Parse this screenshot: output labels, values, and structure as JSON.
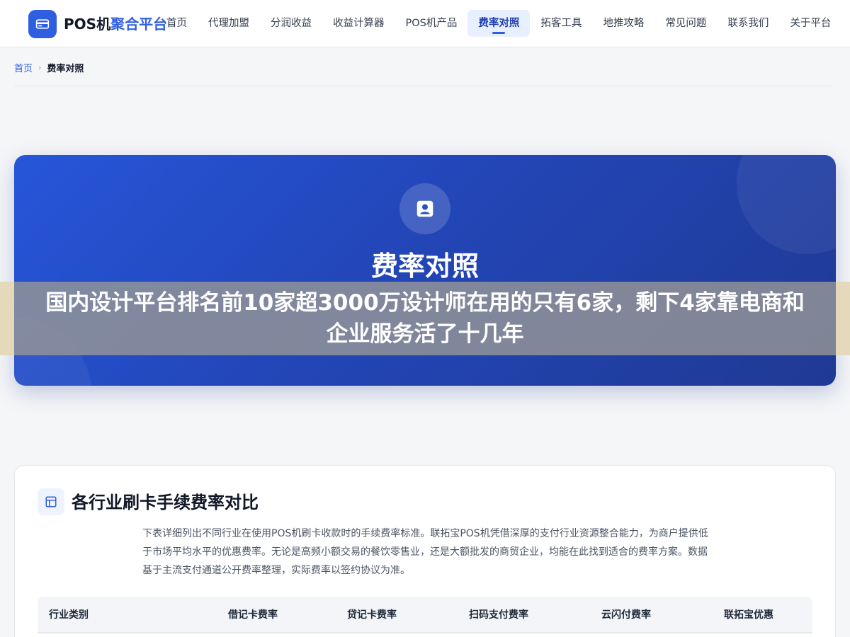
{
  "header": {
    "brand_prefix": "POS机",
    "brand_suffix": "聚合平台",
    "logo_icon": "credit-card-icon",
    "nav": [
      {
        "label": "首页",
        "active": false
      },
      {
        "label": "代理加盟",
        "active": false
      },
      {
        "label": "分润收益",
        "active": false
      },
      {
        "label": "收益计算器",
        "active": false
      },
      {
        "label": "POS机产品",
        "active": false
      },
      {
        "label": "费率对照",
        "active": true
      },
      {
        "label": "拓客工具",
        "active": false
      },
      {
        "label": "地推攻略",
        "active": false
      },
      {
        "label": "常见问题",
        "active": false
      },
      {
        "label": "联系我们",
        "active": false
      },
      {
        "label": "关于平台",
        "active": false
      }
    ]
  },
  "breadcrumb": {
    "home": "首页",
    "separator": "›",
    "current": "费率对照"
  },
  "hero": {
    "icon": "contact-card-icon",
    "title": "费率对照"
  },
  "overlay": {
    "text": "国内设计平台排名前10家超3000万设计师在用的只有6家，剩下4家靠电商和企业服务活了十几年"
  },
  "section": {
    "icon": "table-icon",
    "title": "各行业刷卡手续费率对比",
    "description": "下表详细列出不同行业在使用POS机刷卡收款时的手续费率标准。联拓宝POS机凭借深厚的支付行业资源整合能力，为商户提供低于市场平均水平的优惠费率。无论是高频小额交易的餐饮零售业，还是大额批发的商贸企业，均能在此找到适合的费率方案。数据基于主流支付通道公开费率整理，实际费率以签约协议为准。",
    "table_headers": [
      "行业类别",
      "借记卡费率",
      "贷记卡费率",
      "扫码支付费率",
      "云闪付费率",
      "联拓宝优惠"
    ]
  },
  "colors": {
    "accent": "#2f5fe0",
    "hero_start": "#2656d9",
    "hero_end": "#1f3a94"
  }
}
